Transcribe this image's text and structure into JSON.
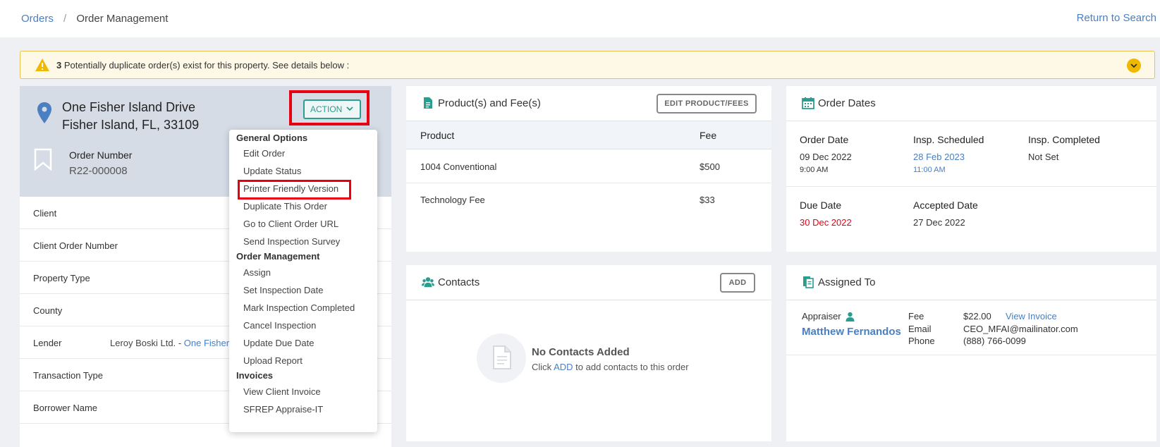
{
  "breadcrumb": {
    "root": "Orders",
    "separator": "/",
    "current": "Order Management"
  },
  "return_link": "Return to Search",
  "alert": {
    "count": "3",
    "text": "Potentially duplicate order(s) exist for this property. See details below :"
  },
  "property": {
    "address_line1": "One Fisher Island Drive",
    "address_line2": "Fisher Island, FL, 33109",
    "order_number_label": "Order Number",
    "order_number": "R22-000008",
    "action_label": "ACTION"
  },
  "fields": [
    {
      "label": "Client",
      "value": ""
    },
    {
      "label": "Client Order Number",
      "value": ""
    },
    {
      "label": "Property Type",
      "value": ""
    },
    {
      "label": "County",
      "value": ""
    },
    {
      "label": "Lender",
      "value": "Leroy Boski Ltd. - ",
      "link": "One Fisher"
    },
    {
      "label": "Transaction Type",
      "value": ""
    },
    {
      "label": "Borrower Name",
      "value": ""
    }
  ],
  "action_menu": {
    "groups": [
      {
        "title": "General Options",
        "items": [
          "Edit Order",
          "Update Status",
          "Printer Friendly Version",
          "Duplicate This Order",
          "Go to Client Order URL",
          "Send Inspection Survey"
        ]
      },
      {
        "title": "Order Management",
        "items": [
          "Assign",
          "Set Inspection Date",
          "Mark Inspection Completed",
          "Cancel Inspection",
          "Update Due Date",
          "Upload Report"
        ]
      },
      {
        "title": "Invoices",
        "items": [
          "View Client Invoice",
          "SFREP Appraise-IT"
        ]
      }
    ]
  },
  "products": {
    "title": "Product(s) and Fee(s)",
    "edit_button": "EDIT PRODUCT/FEES",
    "col_product": "Product",
    "col_fee": "Fee",
    "rows": [
      {
        "product": "1004 Conventional",
        "fee": "$500"
      },
      {
        "product": "Technology Fee",
        "fee": "$33"
      }
    ]
  },
  "contacts": {
    "title": "Contacts",
    "add_button": "ADD",
    "empty_title": "No Contacts Added",
    "empty_pre": "Click",
    "empty_link": "ADD",
    "empty_post": "to add contacts to this order"
  },
  "dates": {
    "title": "Order Dates",
    "order_date_label": "Order Date",
    "order_date": "09 Dec 2022",
    "order_time": "9:00 AM",
    "insp_sched_label": "Insp. Scheduled",
    "insp_sched": "28 Feb 2023",
    "insp_sched_time": "11:00 AM",
    "insp_completed_label": "Insp. Completed",
    "insp_completed": "Not Set",
    "due_date_label": "Due Date",
    "due_date": "30 Dec 2022",
    "accepted_date_label": "Accepted Date",
    "accepted_date": "27 Dec 2022"
  },
  "assigned": {
    "title": "Assigned To",
    "role": "Appraiser",
    "name": "Matthew Fernandos",
    "fee_label": "Fee",
    "fee": "$22.00",
    "invoice_link": "View Invoice",
    "email_label": "Email",
    "email": "CEO_MFAI@mailinator.com",
    "phone_label": "Phone",
    "phone": "(888) 766-0099"
  },
  "colors": {
    "accent": "#2a9d8f",
    "link": "#4a7fc1",
    "highlight": "#e60012",
    "warning": "#f0b800"
  }
}
